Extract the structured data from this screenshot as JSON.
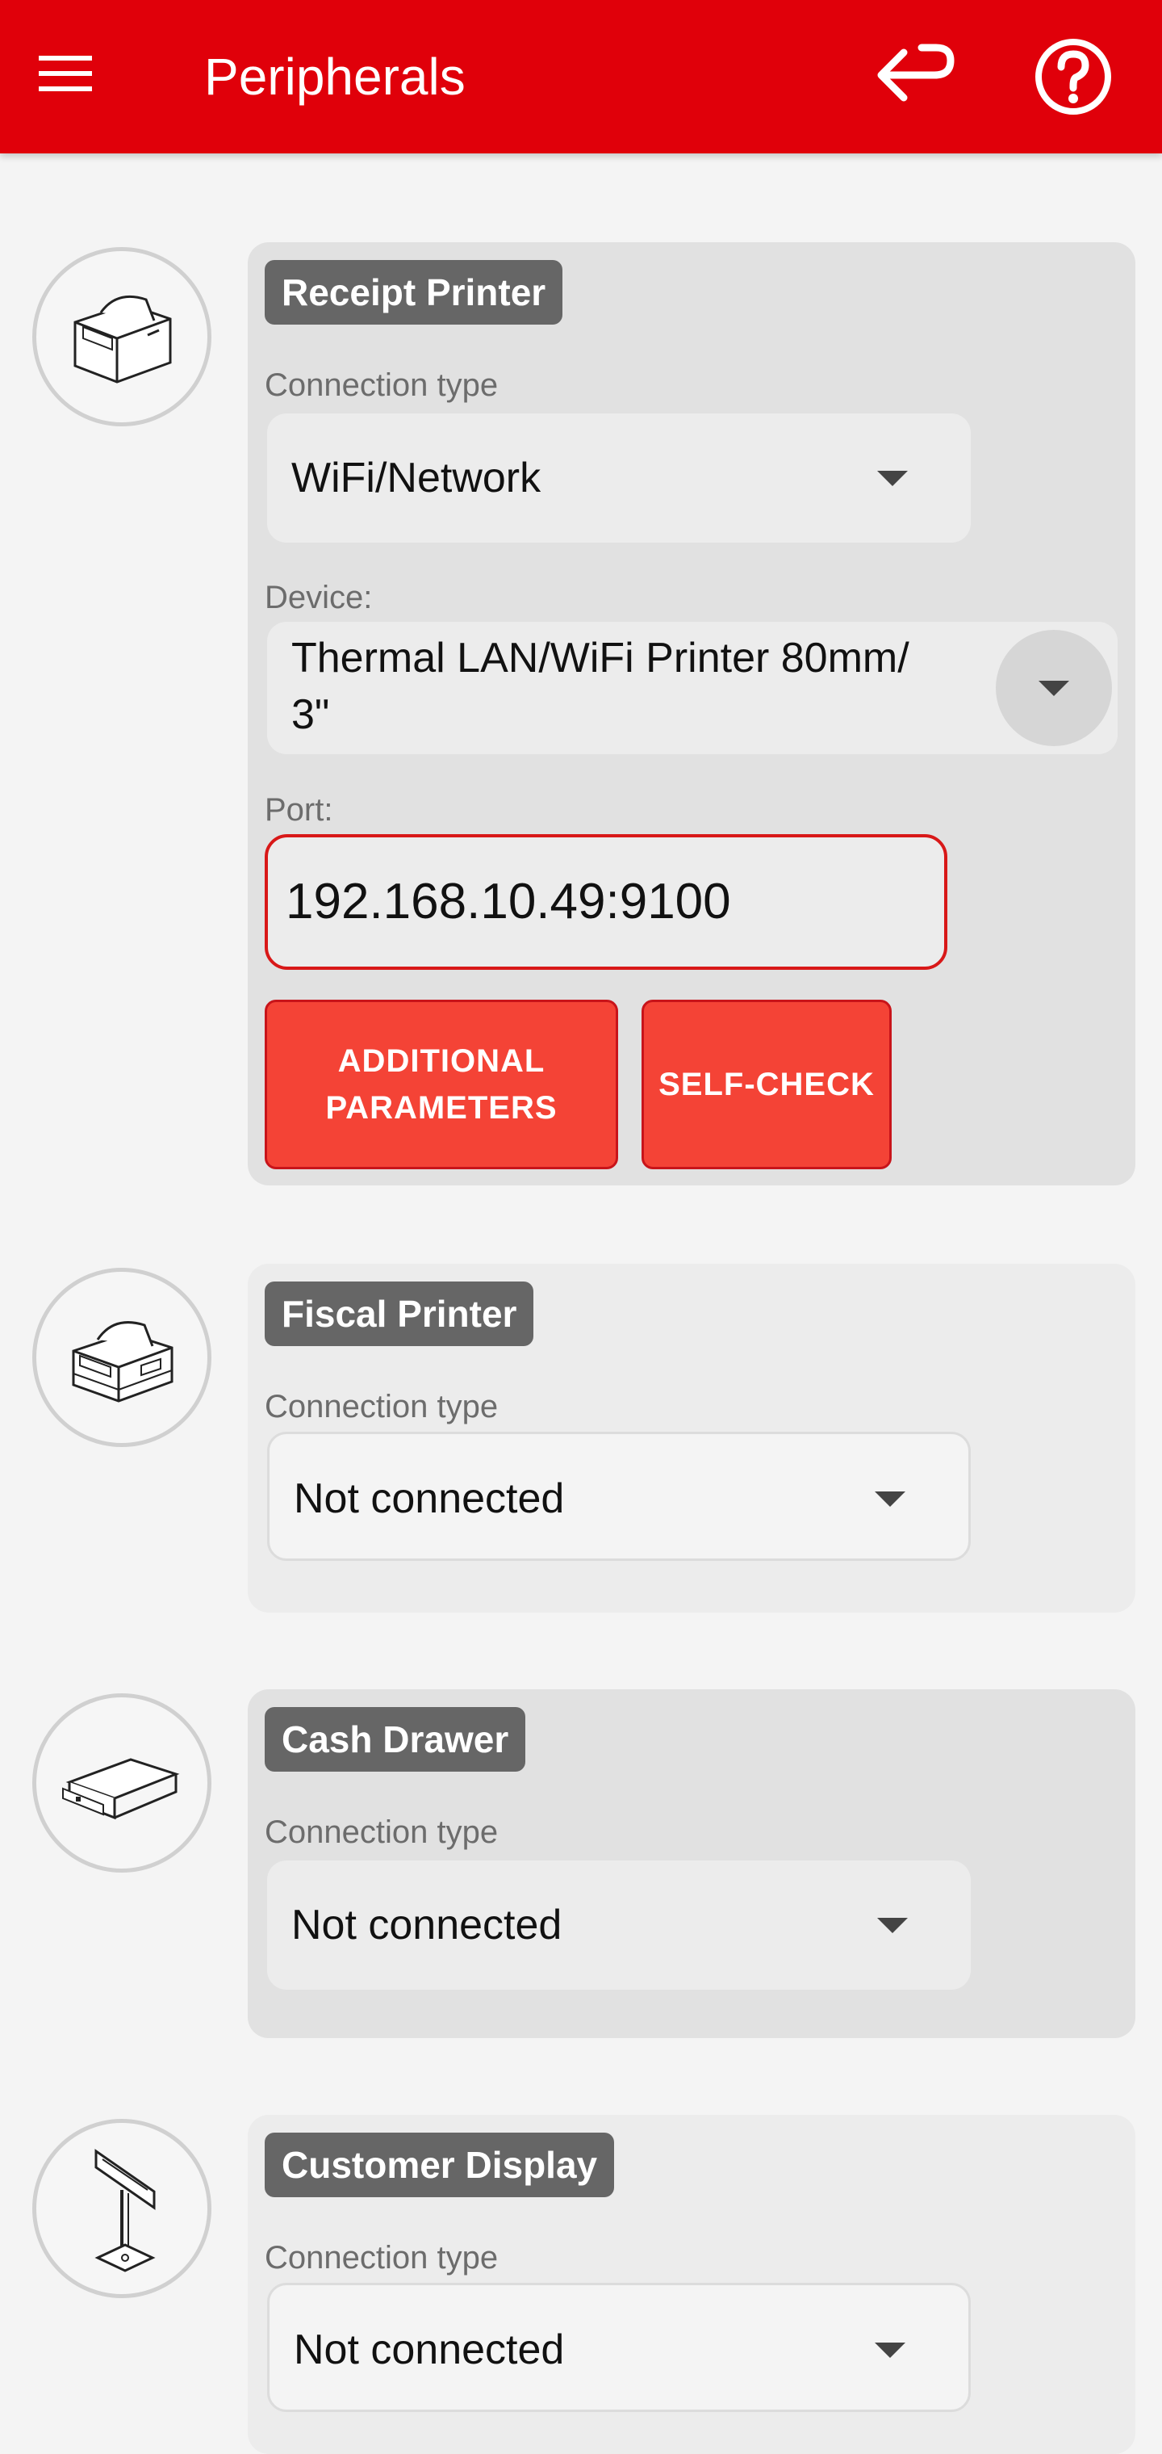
{
  "app_bar": {
    "title": "Peripherals",
    "background_color": "#e0000a",
    "icons": [
      "menu-icon",
      "return-icon",
      "help-icon"
    ]
  },
  "labels": {
    "connection_type": "Connection type",
    "device": "Device:",
    "port": "Port:"
  },
  "receipt_printer": {
    "title": "Receipt Printer",
    "icon": "receipt-printer-icon",
    "connection_type": "WiFi/Network",
    "device": "Thermal LAN/WiFi Printer 80mm/ 3\"",
    "port": "192.168.10.49:9100",
    "additional_parameters_label": "ADDITIONAL PARAMETERS",
    "self_check_label": "SELF-CHECK"
  },
  "fiscal_printer": {
    "title": "Fiscal Printer",
    "icon": "fiscal-printer-icon",
    "connection_type": "Not connected"
  },
  "cash_drawer": {
    "title": "Cash Drawer",
    "icon": "cash-drawer-icon",
    "connection_type": "Not connected"
  },
  "customer_display": {
    "title": "Customer Display",
    "icon": "customer-display-icon",
    "connection_type": "Not connected"
  },
  "colors": {
    "accent_red": "#e0000a",
    "button_red": "#f44336",
    "badge_gray": "#666666"
  }
}
